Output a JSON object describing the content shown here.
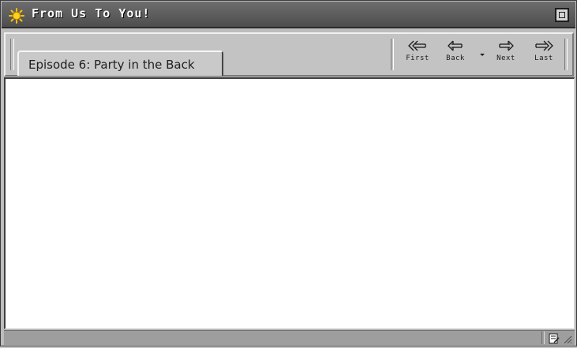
{
  "window": {
    "title": "From Us To You!",
    "title_icon": "sun-icon",
    "accent_color": "#f5c300"
  },
  "toolbar": {
    "tab_label": "Episode 6: Party in the Back",
    "nav": {
      "first_label": "First",
      "back_label": "Back",
      "next_label": "Next",
      "last_label": "Last"
    }
  },
  "icons": {
    "zoom": "zoom-box-icon",
    "first": "first-arrow-icon",
    "back": "back-arrow-icon",
    "history": "dropdown-caret-icon",
    "next": "next-arrow-icon",
    "last": "last-arrow-icon",
    "status": "note-icon",
    "resize": "resize-grip-icon"
  }
}
